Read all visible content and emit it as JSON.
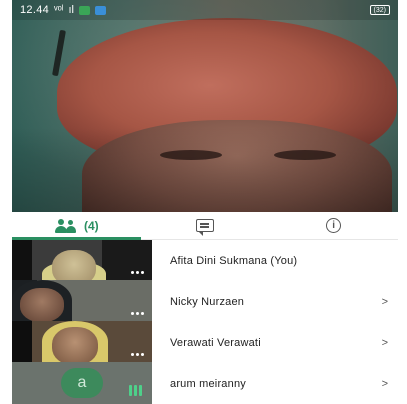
{
  "status_bar": {
    "time": "12.44",
    "network": "ᵛᵒˡ",
    "signal": "ıl",
    "battery": "(32)"
  },
  "tabs": [
    {
      "name": "participants",
      "icon": "people-icon",
      "count": "(4)",
      "active": true
    },
    {
      "name": "chat",
      "icon": "chat-icon",
      "active": false
    },
    {
      "name": "info",
      "icon": "info-icon",
      "active": false
    }
  ],
  "participants": [
    {
      "name": "Afita Dini Sukmana (You)",
      "chevron": "",
      "indicator": "dots-icon"
    },
    {
      "name": "Nicky Nurzaen",
      "chevron": ">",
      "indicator": "dots-icon"
    },
    {
      "name": "Verawati Verawati",
      "chevron": ">",
      "indicator": "dots-icon"
    },
    {
      "name": "arum meiranny",
      "chevron": ">",
      "avatar_letter": "a",
      "indicator": "audio-bars-icon"
    }
  ],
  "colors": {
    "accent": "#2a8f61",
    "avatar": "#3d8a5c",
    "audio": "#4ed08a"
  }
}
